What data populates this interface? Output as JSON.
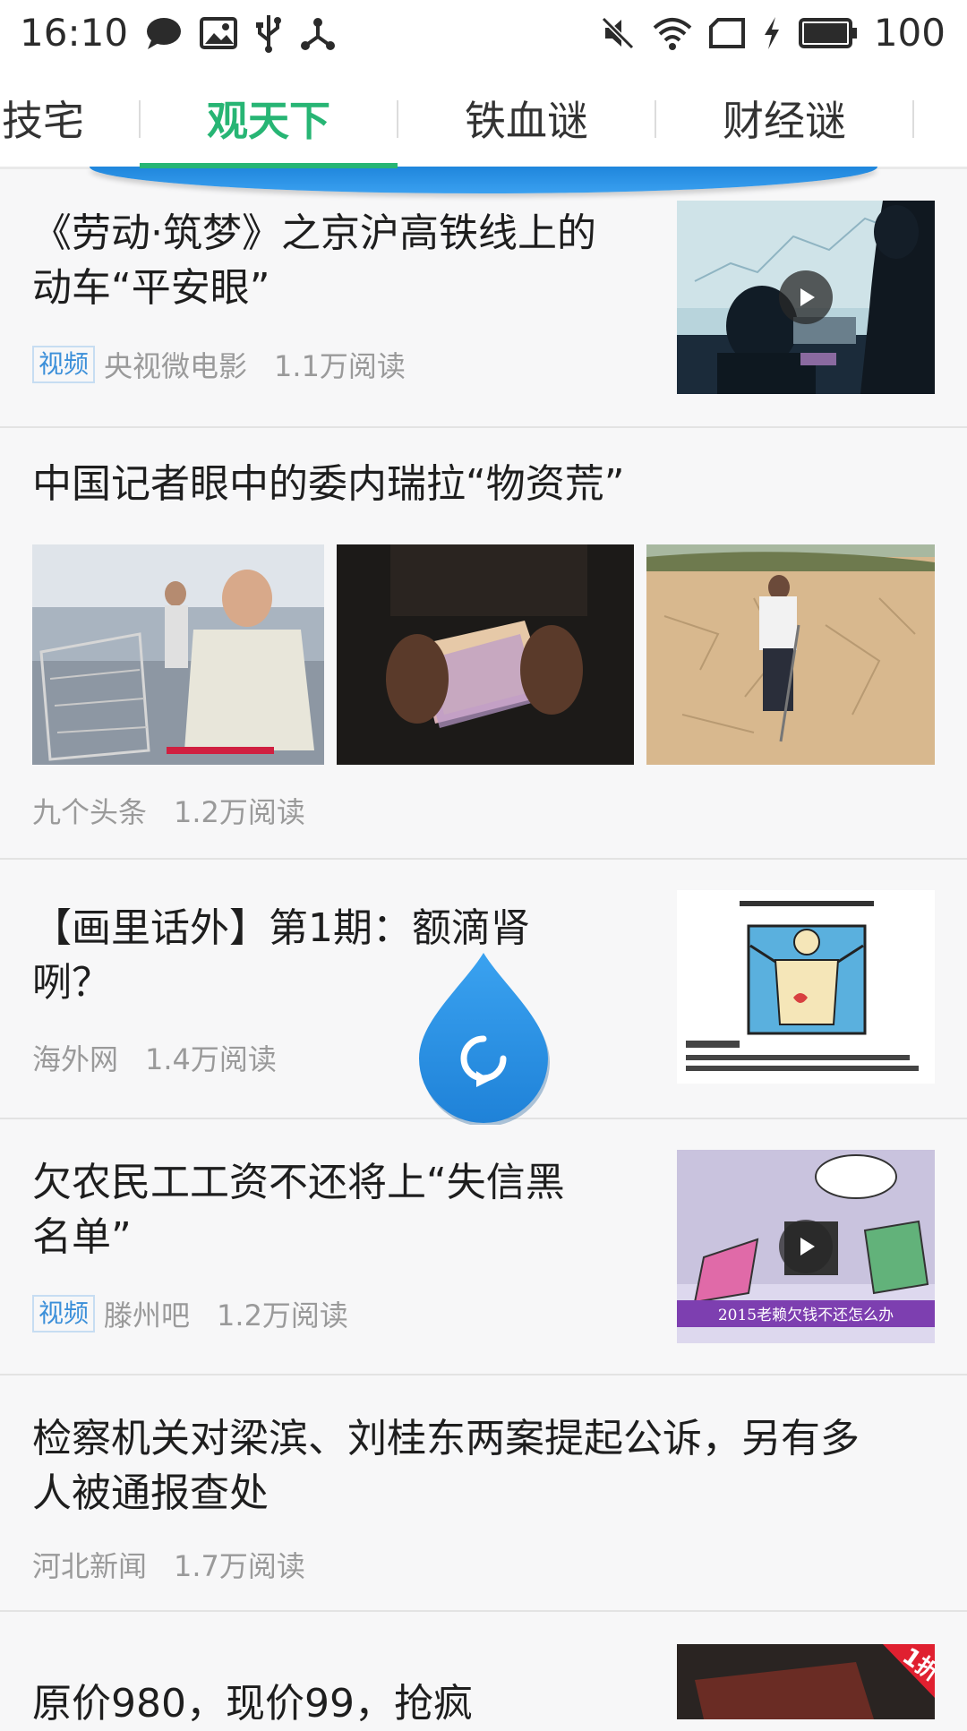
{
  "status_bar": {
    "time": "16:10",
    "battery": "100",
    "left_icons": [
      "chat-icon",
      "image-icon",
      "usb-icon",
      "share-node-icon"
    ],
    "right_icons": [
      "mute-icon",
      "wifi-icon",
      "no-sim-icon",
      "charging-icon",
      "battery-icon"
    ]
  },
  "tabs": [
    {
      "label": "技宅"
    },
    {
      "label": "观天下",
      "active": true
    },
    {
      "label": "铁血谜"
    },
    {
      "label": "财经谜"
    }
  ],
  "feed": [
    {
      "title": "《劳动·筑梦》之京沪高铁线上的动车“平安眼”",
      "title_line1": "《劳动·筑梦》之京沪高铁线上的",
      "title_line2": "动车“平安眼”",
      "tag": "视频",
      "source": "央视微电影",
      "reads": "1.1万阅读",
      "thumb": "video-thumbnail"
    },
    {
      "title": "中国记者眼中的委内瑞拉“物资荒”",
      "source": "九个头条",
      "reads": "1.2万阅读",
      "images": [
        "supermarket-photo",
        "banknotes-photo",
        "dry-field-photo"
      ]
    },
    {
      "title_line1": "【画里话外】第1期：额滴肾",
      "title_line2": "咧？",
      "source": "海外网",
      "reads": "1.4万阅读",
      "thumb": "kidney-cartoon-thumbnail"
    },
    {
      "title_line1": "欠农民工工资不还将上“失信黑",
      "title_line2": "名单”",
      "tag": "视频",
      "source": "滕州吧",
      "reads": "1.2万阅读",
      "thumb": "cartoon-video-thumbnail",
      "thumb_caption": "2015老赖欠钱不还怎么办"
    },
    {
      "title_line1": "检察机关对梁滨、刘桂东两案提起公诉，另有多",
      "title_line2": "人被通报查处",
      "source": "河北新闻",
      "reads": "1.7万阅读"
    },
    {
      "title_line1": "原价980，现价99，抢疯",
      "badge": "1折",
      "thumb": "wallet-ad-thumbnail"
    }
  ],
  "colors": {
    "accent_green": "#27b574",
    "refresh_blue": "#2a8fe6",
    "tag_blue": "#3b8fd9"
  }
}
